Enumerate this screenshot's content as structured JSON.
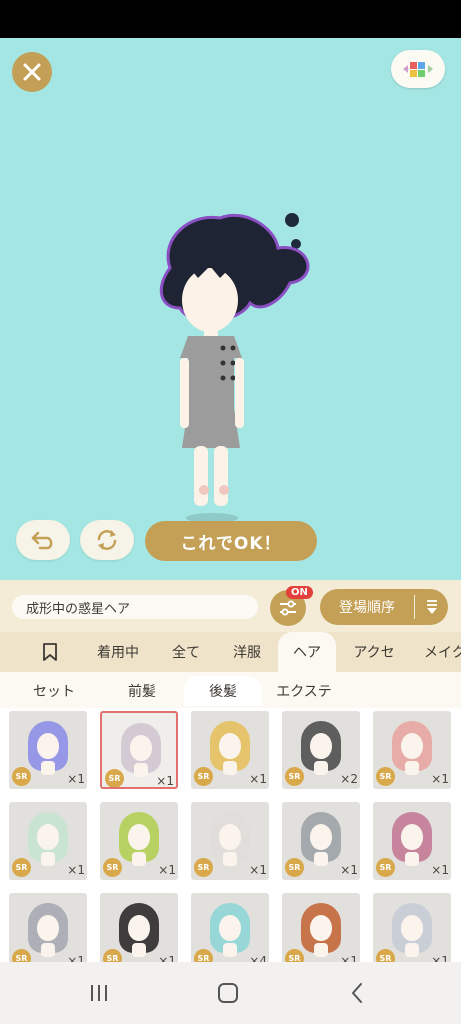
{
  "stage": {
    "ok_button": "これでOK！"
  },
  "infobar": {
    "item_name": "成形中の惑星ヘア",
    "filter_badge": "ON",
    "sort_label": "登場順序"
  },
  "tabs": [
    "着用中",
    "全て",
    "洋服",
    "ヘア",
    "アクセ",
    "メイク"
  ],
  "subtabs": [
    "セット",
    "前髪",
    "後髪",
    "エクステ"
  ],
  "items": [
    {
      "rarity": "SR",
      "count": "×1",
      "hair": "#8f8fe8"
    },
    {
      "rarity": "SR",
      "count": "×1",
      "hair": "#cfc5d2"
    },
    {
      "rarity": "SR",
      "count": "×1",
      "hair": "#e6c15f"
    },
    {
      "rarity": "SR",
      "count": "×2",
      "hair": "#505050"
    },
    {
      "rarity": "SR",
      "count": "×1",
      "hair": "#e8a6a2"
    },
    {
      "rarity": "SR",
      "count": "×1",
      "hair": "#c6e4d2"
    },
    {
      "rarity": "SR",
      "count": "×1",
      "hair": "#b4cf55"
    },
    {
      "rarity": "SR",
      "count": "×1",
      "hair": "#e0ddd9"
    },
    {
      "rarity": "SR",
      "count": "×1",
      "hair": "#9ca3a6"
    },
    {
      "rarity": "SR",
      "count": "×1",
      "hair": "#c47a96"
    },
    {
      "rarity": "SR",
      "count": "×1",
      "hair": "#a8abb2"
    },
    {
      "rarity": "SR",
      "count": "×1",
      "hair": "#2c2a2a"
    },
    {
      "rarity": "SR",
      "count": "×4",
      "hair": "#8fd6d6"
    },
    {
      "rarity": "SR",
      "count": "×1",
      "hair": "#c4683b"
    },
    {
      "rarity": "SR",
      "count": "×1",
      "hair": "#c6ccd6"
    }
  ],
  "colors": {
    "stage_bg": "#a4e6e3",
    "accent_gold": "#c4a056",
    "badge_red": "#e4403b",
    "selected_border": "#e2706e"
  },
  "icons": {
    "close": "close-icon",
    "menu": "colorful-tiles-icon",
    "undo": "undo-icon",
    "rotate": "rotate-icon",
    "filter": "sliders-icon",
    "sort": "sort-list-icon",
    "bookmark": "bookmark-icon",
    "nav_recent": "recent-apps-icon",
    "nav_home": "home-icon",
    "nav_back": "back-icon"
  },
  "selected_item_index": 1,
  "active_tab": "ヘア",
  "active_subtab": "後髪"
}
